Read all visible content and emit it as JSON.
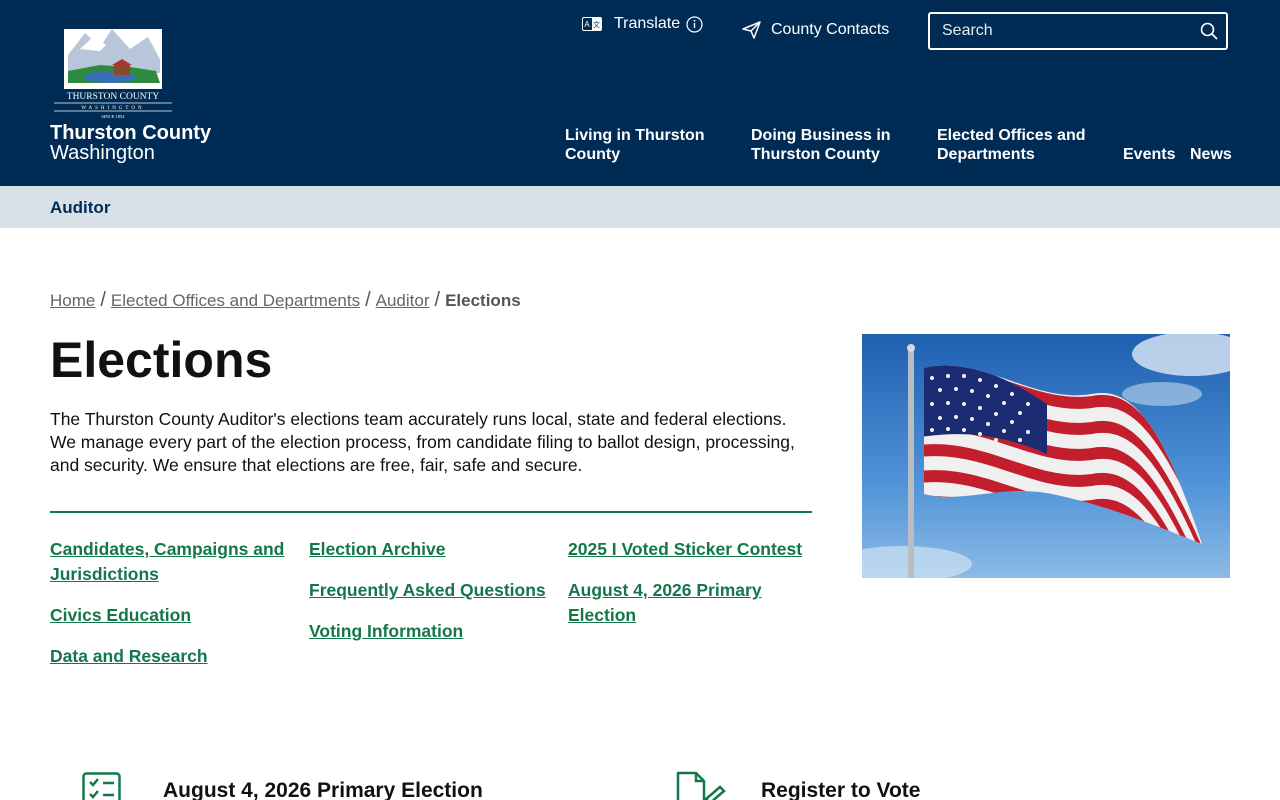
{
  "header": {
    "seal_text": "THURSTON COUNTY",
    "seal_sub": "WASHINGTON",
    "seal_since": "SINCE 1852",
    "title": "Thurston County",
    "subtitle": "Washington",
    "translate_label": "Translate",
    "contacts_label": "County Contacts",
    "search_placeholder": "Search",
    "nav": [
      {
        "label": "Living in Thurston County"
      },
      {
        "label": "Doing Business in Thurston County"
      },
      {
        "label": "Elected Offices and Departments"
      },
      {
        "label": "Events"
      },
      {
        "label": "News"
      }
    ]
  },
  "subbar": {
    "title": "Auditor"
  },
  "breadcrumb": {
    "items": [
      "Home",
      "Elected Offices and Departments",
      "Auditor"
    ],
    "current": "Elections",
    "separator": "/"
  },
  "main": {
    "title": "Elections",
    "intro": "The Thurston County Auditor's elections team accurately runs local, state and federal elections. We manage every part of the election process, from candidate filing to ballot design, processing, and security. We ensure that elections are free, fair, safe and secure.",
    "links": {
      "col1": [
        "Candidates, Campaigns and Jurisdictions",
        "Civics Education",
        "Data and Research"
      ],
      "col2": [
        "Election Archive",
        "Frequently Asked Questions",
        "Voting Information"
      ],
      "col3": [
        "2025 I Voted Sticker Contest",
        "August 4, 2026 Primary Election"
      ]
    },
    "cards": [
      {
        "title": "August 4, 2026 Primary Election",
        "icon": "ballot-list-icon"
      },
      {
        "title": "Register to Vote",
        "icon": "document-pen-icon"
      }
    ]
  },
  "colors": {
    "header_bg": "#002b55",
    "subbar_bg": "#d9e1e8",
    "link_green": "#14774a"
  }
}
